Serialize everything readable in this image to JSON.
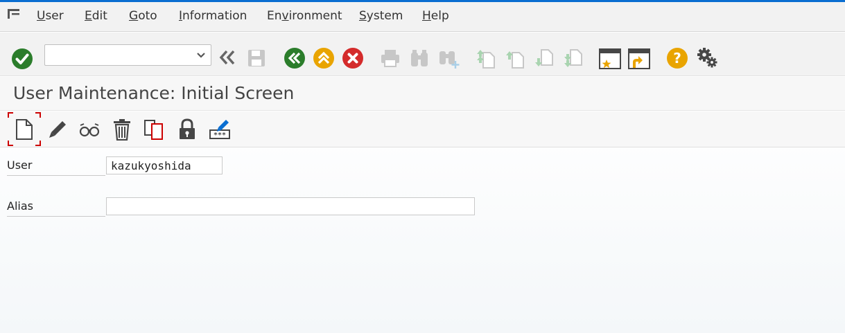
{
  "colors": {
    "accent_line": "#0a6ed1",
    "ok_green": "#2b7d2b",
    "nav_green": "#2b7d2b",
    "nav_orange": "#e9a400",
    "cancel_red": "#d42b2b",
    "help_orange": "#e9a400",
    "icon_dark": "#464646",
    "icon_disabled": "#c7c7c7",
    "icon_disabled_green": "#a9d4b0",
    "focus_red": "#cc0000"
  },
  "menu": {
    "items": [
      {
        "label": "User",
        "mnemonic_index": 0
      },
      {
        "label": "Edit",
        "mnemonic_index": 0
      },
      {
        "label": "Goto",
        "mnemonic_index": 0
      },
      {
        "label": "Information",
        "mnemonic_index": 0
      },
      {
        "label": "Environment",
        "mnemonic_index": 2
      },
      {
        "label": "System",
        "mnemonic_index": 0
      },
      {
        "label": "Help",
        "mnemonic_index": 0
      }
    ]
  },
  "toolbar": {
    "command_field": {
      "value": "",
      "placeholder": ""
    },
    "icons": [
      "enter-icon",
      "back-double-chevron-icon",
      "save-icon",
      "back-icon",
      "exit-icon",
      "cancel-icon",
      "print-icon",
      "find-icon",
      "find-next-icon",
      "first-page-icon",
      "previous-page-icon",
      "next-page-icon",
      "last-page-icon",
      "create-session-icon",
      "create-shortcut-icon",
      "help-icon",
      "customize-layout-icon"
    ]
  },
  "title": {
    "text": "User Maintenance: Initial Screen"
  },
  "app_toolbar": {
    "icons": [
      "create-document-icon",
      "change-pencil-icon",
      "display-glasses-icon",
      "delete-trash-icon",
      "copy-icon",
      "lock-icon",
      "password-change-icon"
    ]
  },
  "form": {
    "user": {
      "label": "User",
      "value": "kazukyoshida"
    },
    "alias": {
      "label": "Alias",
      "value": ""
    }
  }
}
